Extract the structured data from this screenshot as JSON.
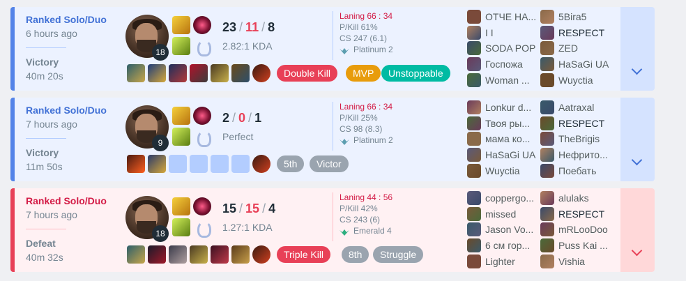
{
  "matches": [
    {
      "result_type": "win",
      "queue": "Ranked Solo/Duo",
      "time_ago": "6 hours ago",
      "result": "Victory",
      "duration": "40m 20s",
      "champion_level": "18",
      "kills": "23",
      "deaths": "11",
      "assists": "8",
      "kda_ratio": "2.82:1 KDA",
      "laning": "Laning 66 : 34",
      "pkill": "P/Kill 61%",
      "cs": "CS 247 (6.1)",
      "tier": "Platinum 2",
      "badges": [
        {
          "label": "Double Kill",
          "color": "red"
        },
        {
          "label": "MVP",
          "color": "orange"
        },
        {
          "label": "Unstoppable",
          "color": "green"
        }
      ],
      "team_left": [
        "ОТЧЕ НА...",
        "I I",
        "SODA POP",
        "Госпожа",
        "Woman ..."
      ],
      "team_right": [
        "5Bira5",
        "RESPECT",
        "ZED",
        "HaSaGi UA",
        "Wuyctia"
      ]
    },
    {
      "result_type": "win",
      "queue": "Ranked Solo/Duo",
      "time_ago": "7 hours ago",
      "result": "Victory",
      "duration": "11m 50s",
      "champion_level": "9",
      "kills": "2",
      "deaths": "0",
      "assists": "1",
      "kda_ratio": "Perfect",
      "laning": "Laning 66 : 34",
      "pkill": "P/Kill 25%",
      "cs": "CS 98 (8.3)",
      "tier": "Platinum 2",
      "badges": [
        {
          "label": "5th",
          "color": "gray"
        },
        {
          "label": "Victor",
          "color": "gray"
        }
      ],
      "team_left": [
        "Lonkur d...",
        "Твоя ры...",
        "мама ко...",
        "HaSaGi UA",
        "Wuyctia"
      ],
      "team_right": [
        "Aatraxal",
        "RESPECT",
        "TheBrigis",
        "Нефрито...",
        "Поебать"
      ]
    },
    {
      "result_type": "loss",
      "queue": "Ranked Solo/Duo",
      "time_ago": "7 hours ago",
      "result": "Defeat",
      "duration": "40m 32s",
      "champion_level": "18",
      "kills": "15",
      "deaths": "15",
      "assists": "4",
      "kda_ratio": "1.27:1 KDA",
      "laning": "Laning 44 : 56",
      "pkill": "P/Kill 42%",
      "cs": "CS 243 (6)",
      "tier": "Emerald 4",
      "badges": [
        {
          "label": "Triple Kill",
          "color": "red"
        },
        {
          "label": "8th",
          "color": "gray"
        },
        {
          "label": "Struggle",
          "color": "gray"
        }
      ],
      "team_left": [
        "coppergo...",
        "missed",
        "Jason Vo...",
        "6 см гор...",
        "Lighter"
      ],
      "team_right": [
        "alulaks",
        "RESPECT",
        "mRLooDoo",
        "Puss Kai ...",
        "Vishia"
      ]
    }
  ],
  "colors": {
    "win_accent": "#5383e8",
    "loss_accent": "#e84057",
    "win_bg": "#ecf2ff",
    "loss_bg": "#fff1f3"
  }
}
